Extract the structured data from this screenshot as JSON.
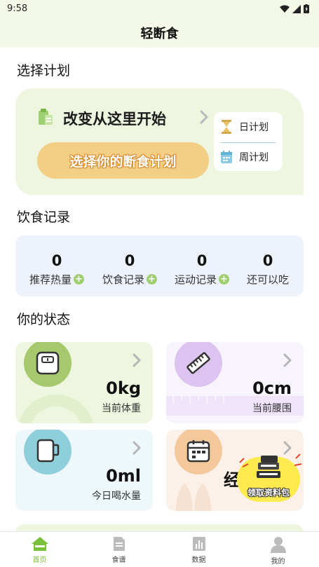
{
  "status_bar": {
    "time": "9:58"
  },
  "app_bar": {
    "title": "轻断食"
  },
  "sections": {
    "plan": "选择计划",
    "diet": "饮食记录",
    "status": "你的状态"
  },
  "plan_card": {
    "headline": "改变从这里开始",
    "cta": "选择你的断食计划",
    "menu": [
      {
        "label": "日计划",
        "icon": "hourglass-icon"
      },
      {
        "label": "周计划",
        "icon": "calendar-icon"
      }
    ]
  },
  "diet_record": [
    {
      "value": "0",
      "label": "推荐热量",
      "plus": true
    },
    {
      "value": "0",
      "label": "饮食记录",
      "plus": true
    },
    {
      "value": "0",
      "label": "运动记录",
      "plus": true
    },
    {
      "value": "0",
      "label": "还可以吃",
      "plus": false
    }
  ],
  "status_cards": {
    "weight": {
      "value": "0kg",
      "label": "当前体重"
    },
    "waist": {
      "value": "0cm",
      "label": "当前腰围"
    },
    "water": {
      "value": "0ml",
      "label": "今日喝水量"
    },
    "period": {
      "value": "经"
    }
  },
  "gift_badge": {
    "label": "领取资料包"
  },
  "bottom_nav": [
    {
      "label": "首页",
      "icon": "home-icon",
      "active": true
    },
    {
      "label": "食谱",
      "icon": "document-icon",
      "active": false
    },
    {
      "label": "数据",
      "icon": "bar-chart-icon",
      "active": false
    },
    {
      "label": "我的",
      "icon": "user-icon",
      "active": false
    }
  ],
  "colors": {
    "accent_green": "#7bbf3b",
    "plan_bg": "#eef6e0",
    "cta_bg": "#f3cf86",
    "diet_bg": "#eef3fb"
  }
}
